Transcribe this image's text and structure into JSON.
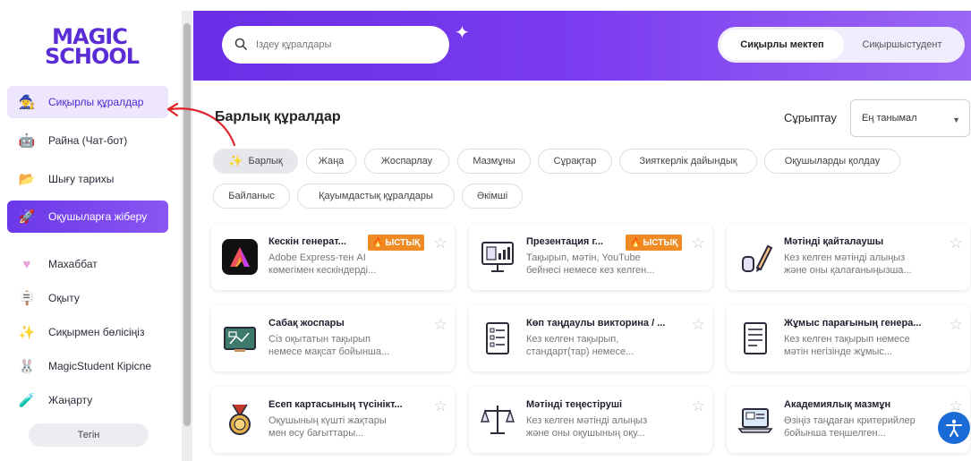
{
  "logo": {
    "line1": "MAGIC",
    "line2": "SCHOOL"
  },
  "sidebar": {
    "items": [
      {
        "label": "Сиқырлы құралдар",
        "icon": "magic-hat-icon"
      },
      {
        "label": "Райна (Чат-бот)",
        "icon": "robot-icon"
      },
      {
        "label": "Шығу тарихы",
        "icon": "folder-icon"
      },
      {
        "label": "Оқушыларға жіберу",
        "icon": "rocket-icon"
      },
      {
        "label": "Махаббат",
        "icon": "heart-icon"
      },
      {
        "label": "Оқыту",
        "icon": "easel-icon"
      },
      {
        "label": "Сиқырмен бөлісіңіз",
        "icon": "sparkle-icon"
      },
      {
        "label": "MagicStudent Кірісne",
        "icon": "bunny-icon"
      },
      {
        "label": "Жаңарту",
        "icon": "potion-icon"
      }
    ],
    "free_label": "Тегін"
  },
  "header": {
    "search_placeholder": "Іздеу құралдары",
    "toggle": {
      "on": "Сиқырлы мектеп",
      "off": "Сиқыршыстудент"
    }
  },
  "main": {
    "title": "Барлық құралдар",
    "sort_label": "Сұрыптау",
    "sort_value": "Ең танымал",
    "chips": [
      "Барлық",
      "Жаңа",
      "Жоспарлау",
      "Мазмұны",
      "Сұрақтар",
      "Зияткерлік дайындық",
      "Оқушыларды қолдау",
      "Байланыс",
      "Қауымдастық құралдары",
      "Әкімші"
    ],
    "hot_label": "ЫСТЫҚ",
    "cards": [
      {
        "title": "Кескін генерат...",
        "desc1": "Adobe Express-тен AI",
        "desc2": "көмегімен кескіндерді...",
        "hot": true,
        "icon": "adobe-express-icon"
      },
      {
        "title": "Презентация г...",
        "desc1": "Тақырып, мәтін, YouTube",
        "desc2": "бейнесі немесе кез келген...",
        "hot": true,
        "icon": "presentation-icon"
      },
      {
        "title": "Мәтінді қайталаушы",
        "desc1": "Кез келген мәтінді алыңыз",
        "desc2": "және оны қалағаныңызша...",
        "hot": false,
        "icon": "pencil-icon"
      },
      {
        "title": "Сабақ жоспары",
        "desc1": "Сіз оқытатын тақырып",
        "desc2": "немесе мақсат бойынша...",
        "hot": false,
        "icon": "chalkboard-icon"
      },
      {
        "title": "Көп таңдаулы викторина / ...",
        "desc1": "Кез келген тақырып,",
        "desc2": "стандарт(тар) немесе...",
        "hot": false,
        "icon": "quiz-icon"
      },
      {
        "title": "Жұмыс парағының генера...",
        "desc1": "Кез келген тақырып немесе",
        "desc2": "мәтін негізінде жұмыс...",
        "hot": false,
        "icon": "worksheet-icon"
      },
      {
        "title": "Есеп картасының түсінікт...",
        "desc1": "Оқушының күшті жақтары",
        "desc2": "мен өсу бағыттары...",
        "hot": false,
        "icon": "medal-icon"
      },
      {
        "title": "Мәтінді теңестіруші",
        "desc1": "Кез келген мәтінді алыңыз",
        "desc2": "және оны оқушының оқу...",
        "hot": false,
        "icon": "balance-icon"
      },
      {
        "title": "Академиялық мазмұн",
        "desc1": "Өзіңіз таңдаған критерийлер",
        "desc2": "бойынша теңшелген...",
        "hot": false,
        "icon": "laptop-icon"
      }
    ]
  },
  "colors": {
    "accent": "#6a2ee6",
    "active_bg": "#eee6fd",
    "hot": "#f08a24",
    "annotation": "#e0262b"
  }
}
